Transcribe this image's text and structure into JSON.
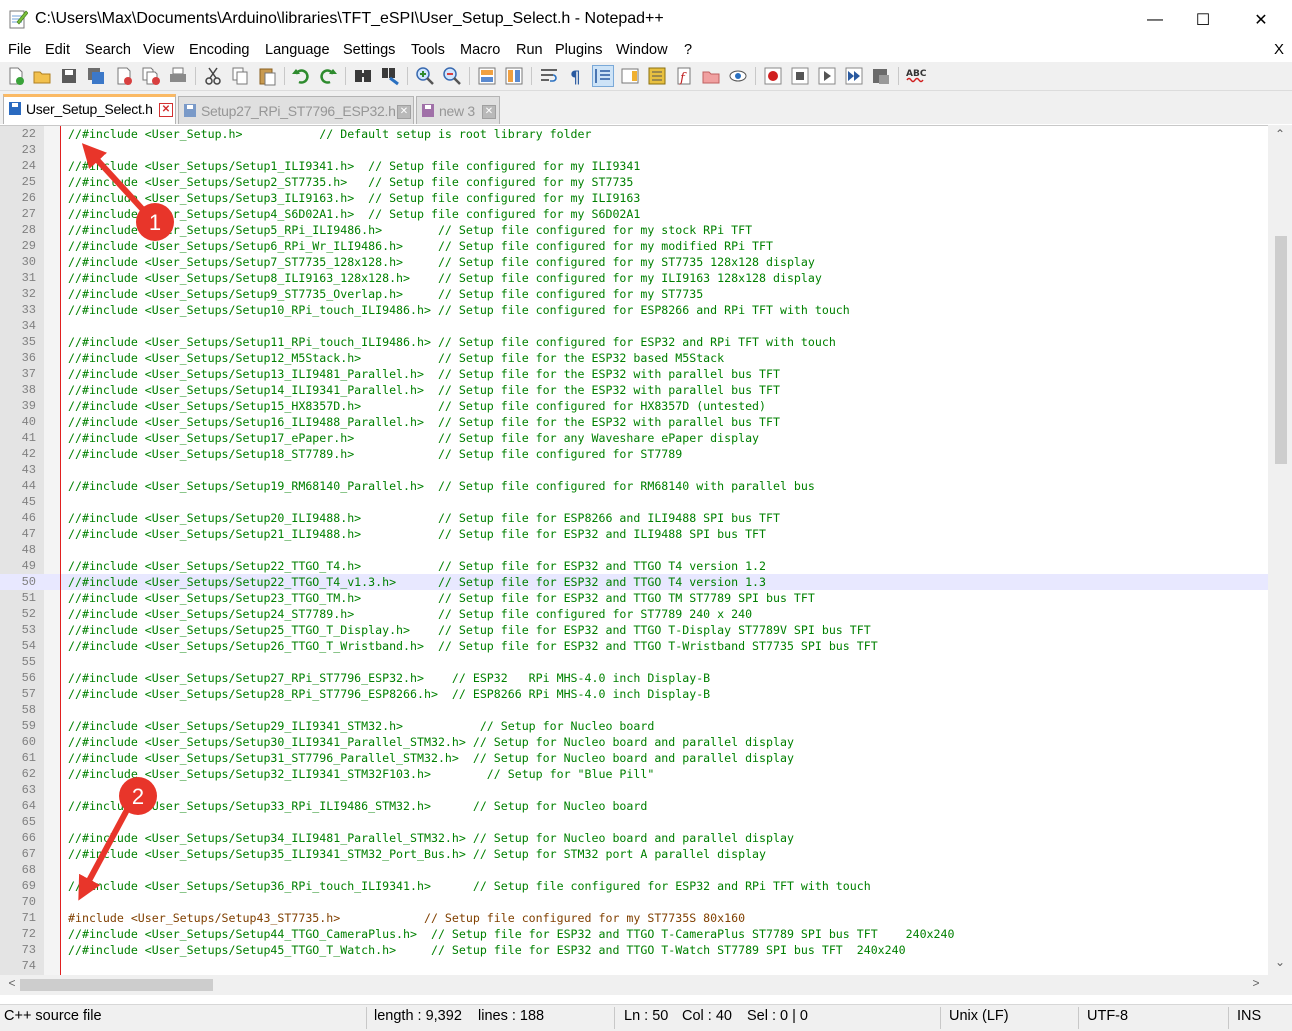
{
  "window": {
    "title": "C:\\Users\\Max\\Documents\\Arduino\\libraries\\TFT_eSPI\\User_Setup_Select.h - Notepad++",
    "minimize_glyph": "—",
    "maximize_glyph": "☐",
    "close_glyph": "✕"
  },
  "menu": {
    "items": [
      "File",
      "Edit",
      "Search",
      "View",
      "Encoding",
      "Language",
      "Settings",
      "Tools",
      "Macro",
      "Run",
      "Plugins",
      "Window",
      "?"
    ],
    "close_label": "X"
  },
  "toolbar": {
    "icons": [
      "new-file-icon",
      "open-file-icon",
      "save-icon",
      "save-all-icon",
      "close-icon",
      "close-all-icon",
      "print-icon",
      "cut-icon",
      "copy-icon",
      "paste-icon",
      "undo-icon",
      "redo-icon",
      "find-icon",
      "replace-icon",
      "zoom-in-icon",
      "zoom-out-icon",
      "sync-vertical-icon",
      "sync-horizontal-icon",
      "word-wrap-icon",
      "show-all-chars-icon",
      "indent-guide-icon",
      "document-map-icon",
      "function-list-icon",
      "folder-workspace-icon",
      "monitoring-icon",
      "record-macro-icon",
      "stop-macro-icon",
      "play-macro-icon",
      "run-macro-multiple-icon",
      "save-macro-icon",
      "spell-check-icon"
    ]
  },
  "tabs": [
    {
      "label": "User_Setup_Select.h",
      "active": true,
      "close": "✕"
    },
    {
      "label": "Setup27_RPi_ST7796_ESP32.h",
      "active": false,
      "close": "✕"
    },
    {
      "label": "new 3",
      "active": false,
      "close": "✕"
    }
  ],
  "editor": {
    "current_line": 50,
    "lines": [
      {
        "n": "22",
        "t": "//#include <User_Setup.h>           // Default setup is root library folder"
      },
      {
        "n": "23",
        "t": ""
      },
      {
        "n": "24",
        "t": "//#include <User_Setups/Setup1_ILI9341.h>  // Setup file configured for my ILI9341"
      },
      {
        "n": "25",
        "t": "//#include <User_Setups/Setup2_ST7735.h>   // Setup file configured for my ST7735"
      },
      {
        "n": "26",
        "t": "//#include <User_Setups/Setup3_ILI9163.h>  // Setup file configured for my ILI9163"
      },
      {
        "n": "27",
        "t": "//#include <User_Setups/Setup4_S6D02A1.h>  // Setup file configured for my S6D02A1"
      },
      {
        "n": "28",
        "t": "//#include <User_Setups/Setup5_RPi_ILI9486.h>        // Setup file configured for my stock RPi TFT"
      },
      {
        "n": "29",
        "t": "//#include <User_Setups/Setup6_RPi_Wr_ILI9486.h>     // Setup file configured for my modified RPi TFT"
      },
      {
        "n": "30",
        "t": "//#include <User_Setups/Setup7_ST7735_128x128.h>     // Setup file configured for my ST7735 128x128 display"
      },
      {
        "n": "31",
        "t": "//#include <User_Setups/Setup8_ILI9163_128x128.h>    // Setup file configured for my ILI9163 128x128 display"
      },
      {
        "n": "32",
        "t": "//#include <User_Setups/Setup9_ST7735_Overlap.h>     // Setup file configured for my ST7735"
      },
      {
        "n": "33",
        "t": "//#include <User_Setups/Setup10_RPi_touch_ILI9486.h> // Setup file configured for ESP8266 and RPi TFT with touch"
      },
      {
        "n": "34",
        "t": ""
      },
      {
        "n": "35",
        "t": "//#include <User_Setups/Setup11_RPi_touch_ILI9486.h> // Setup file configured for ESP32 and RPi TFT with touch"
      },
      {
        "n": "36",
        "t": "//#include <User_Setups/Setup12_M5Stack.h>           // Setup file for the ESP32 based M5Stack"
      },
      {
        "n": "37",
        "t": "//#include <User_Setups/Setup13_ILI9481_Parallel.h>  // Setup file for the ESP32 with parallel bus TFT"
      },
      {
        "n": "38",
        "t": "//#include <User_Setups/Setup14_ILI9341_Parallel.h>  // Setup file for the ESP32 with parallel bus TFT"
      },
      {
        "n": "39",
        "t": "//#include <User_Setups/Setup15_HX8357D.h>           // Setup file configured for HX8357D (untested)"
      },
      {
        "n": "40",
        "t": "//#include <User_Setups/Setup16_ILI9488_Parallel.h>  // Setup file for the ESP32 with parallel bus TFT"
      },
      {
        "n": "41",
        "t": "//#include <User_Setups/Setup17_ePaper.h>            // Setup file for any Waveshare ePaper display"
      },
      {
        "n": "42",
        "t": "//#include <User_Setups/Setup18_ST7789.h>            // Setup file configured for ST7789"
      },
      {
        "n": "43",
        "t": ""
      },
      {
        "n": "44",
        "t": "//#include <User_Setups/Setup19_RM68140_Parallel.h>  // Setup file configured for RM68140 with parallel bus"
      },
      {
        "n": "45",
        "t": ""
      },
      {
        "n": "46",
        "t": "//#include <User_Setups/Setup20_ILI9488.h>           // Setup file for ESP8266 and ILI9488 SPI bus TFT"
      },
      {
        "n": "47",
        "t": "//#include <User_Setups/Setup21_ILI9488.h>           // Setup file for ESP32 and ILI9488 SPI bus TFT"
      },
      {
        "n": "48",
        "t": ""
      },
      {
        "n": "49",
        "t": "//#include <User_Setups/Setup22_TTGO_T4.h>           // Setup file for ESP32 and TTGO T4 version 1.2"
      },
      {
        "n": "50",
        "t": "//#include <User_Setups/Setup22_TTGO_T4_v1.3.h>      // Setup file for ESP32 and TTGO T4 version 1.3"
      },
      {
        "n": "51",
        "t": "//#include <User_Setups/Setup23_TTGO_TM.h>           // Setup file for ESP32 and TTGO TM ST7789 SPI bus TFT"
      },
      {
        "n": "52",
        "t": "//#include <User_Setups/Setup24_ST7789.h>            // Setup file configured for ST7789 240 x 240"
      },
      {
        "n": "53",
        "t": "//#include <User_Setups/Setup25_TTGO_T_Display.h>    // Setup file for ESP32 and TTGO T-Display ST7789V SPI bus TFT"
      },
      {
        "n": "54",
        "t": "//#include <User_Setups/Setup26_TTGO_T_Wristband.h>  // Setup file for ESP32 and TTGO T-Wristband ST7735 SPI bus TFT"
      },
      {
        "n": "55",
        "t": ""
      },
      {
        "n": "56",
        "t": "//#include <User_Setups/Setup27_RPi_ST7796_ESP32.h>    // ESP32   RPi MHS-4.0 inch Display-B"
      },
      {
        "n": "57",
        "t": "//#include <User_Setups/Setup28_RPi_ST7796_ESP8266.h>  // ESP8266 RPi MHS-4.0 inch Display-B"
      },
      {
        "n": "58",
        "t": ""
      },
      {
        "n": "59",
        "t": "//#include <User_Setups/Setup29_ILI9341_STM32.h>           // Setup for Nucleo board"
      },
      {
        "n": "60",
        "t": "//#include <User_Setups/Setup30_ILI9341_Parallel_STM32.h> // Setup for Nucleo board and parallel display"
      },
      {
        "n": "61",
        "t": "//#include <User_Setups/Setup31_ST7796_Parallel_STM32.h>  // Setup for Nucleo board and parallel display"
      },
      {
        "n": "62",
        "t": "//#include <User_Setups/Setup32_ILI9341_STM32F103.h>        // Setup for \"Blue Pill\""
      },
      {
        "n": "63",
        "t": ""
      },
      {
        "n": "64",
        "t": "//#include <User_Setups/Setup33_RPi_ILI9486_STM32.h>      // Setup for Nucleo board"
      },
      {
        "n": "65",
        "t": ""
      },
      {
        "n": "66",
        "t": "//#include <User_Setups/Setup34_ILI9481_Parallel_STM32.h> // Setup for Nucleo board and parallel display"
      },
      {
        "n": "67",
        "t": "//#include <User_Setups/Setup35_ILI9341_STM32_Port_Bus.h> // Setup for STM32 port A parallel display"
      },
      {
        "n": "68",
        "t": ""
      },
      {
        "n": "69",
        "t": "//#include <User_Setups/Setup36_RPi_touch_ILI9341.h>      // Setup file configured for ESP32 and RPi TFT with touch"
      },
      {
        "n": "70",
        "t": ""
      },
      {
        "n": "71",
        "t": "#include <User_Setups/Setup43_ST7735.h>            // Setup file configured for my ST7735S 80x160",
        "pre": true
      },
      {
        "n": "72",
        "t": "//#include <User_Setups/Setup44_TTGO_CameraPlus.h>  // Setup file for ESP32 and TTGO T-CameraPlus ST7789 SPI bus TFT    240x240"
      },
      {
        "n": "73",
        "t": "//#include <User_Setups/Setup45_TTGO_T_Watch.h>     // Setup file for ESP32 and TTGO T-Watch ST7789 SPI bus TFT  240x240"
      },
      {
        "n": "74",
        "t": ""
      }
    ]
  },
  "scroll": {
    "up": "⌃",
    "down": "⌄",
    "left": "<",
    "right": ">"
  },
  "annotations": [
    {
      "label": "1",
      "color": "#e8352a"
    },
    {
      "label": "2",
      "color": "#e8352a"
    }
  ],
  "status": {
    "file_type": "C++ source file",
    "length": "length : 9,392",
    "lines": "lines : 188",
    "ln": "Ln : 50",
    "col": "Col : 40",
    "sel": "Sel : 0 | 0",
    "eol": "Unix (LF)",
    "encoding": "UTF-8",
    "mode": "INS"
  }
}
